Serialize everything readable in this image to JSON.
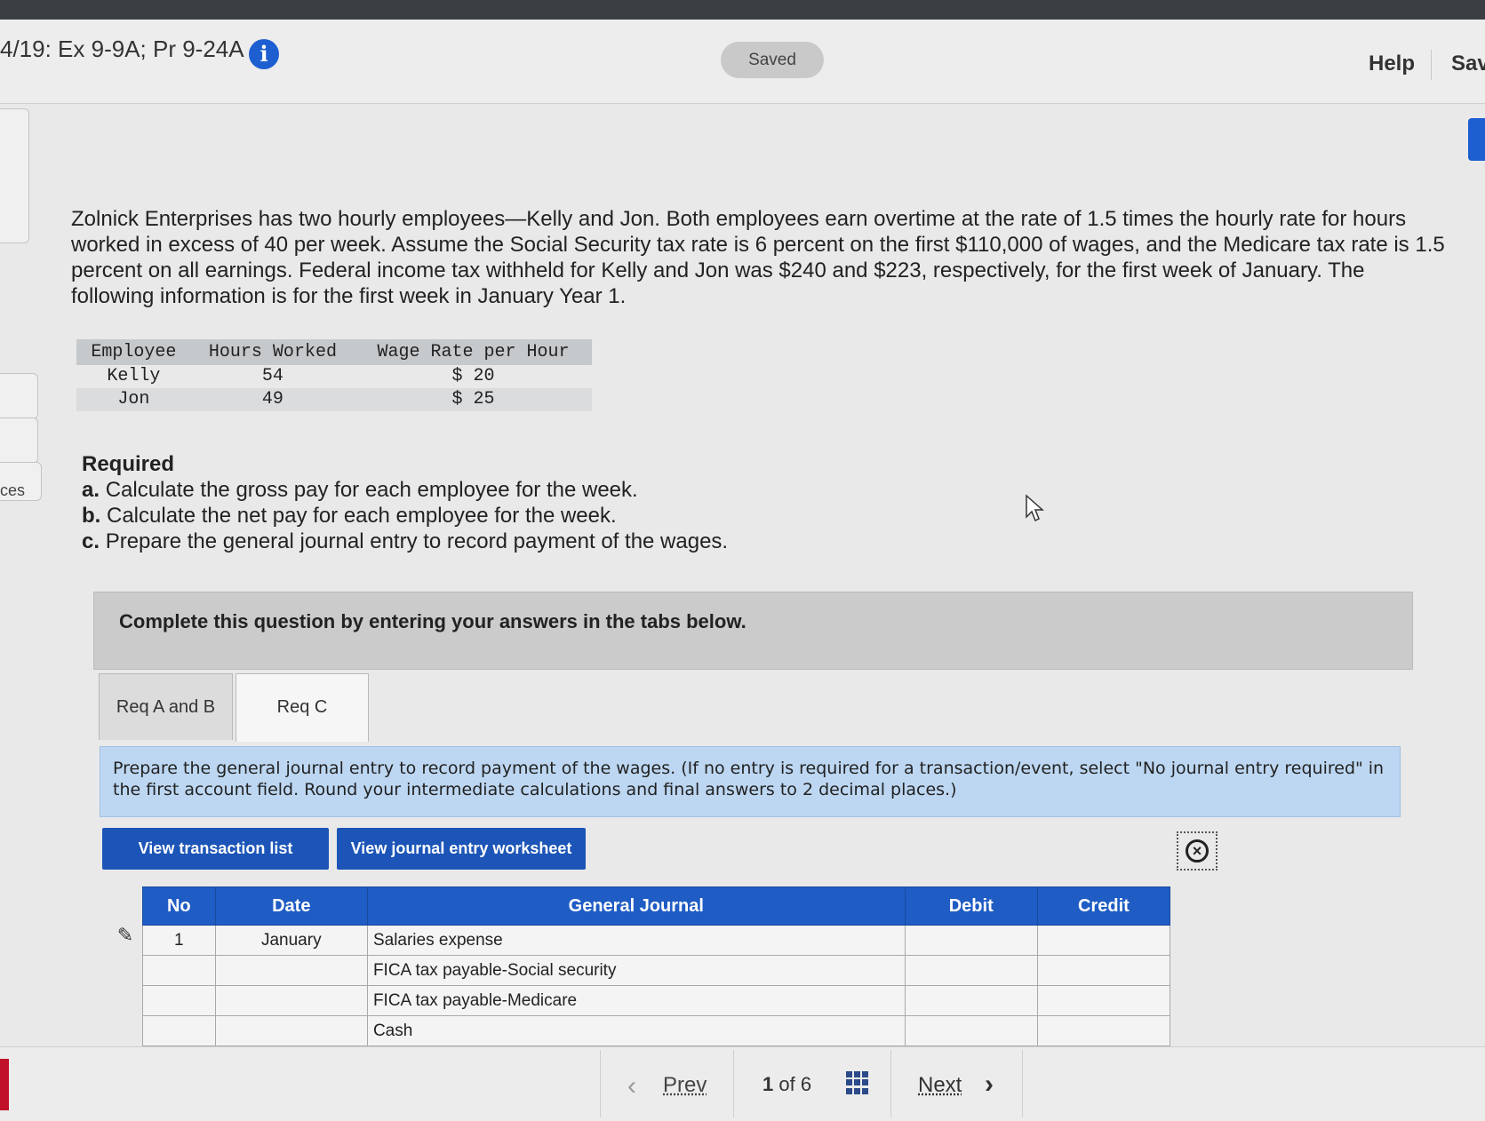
{
  "header": {
    "question_title": "4/19: Ex 9-9A; Pr 9-24A",
    "info_symbol": "i",
    "status": "Saved",
    "help": "Help",
    "save": "Sav"
  },
  "sidebar": {
    "partial_label": "ces"
  },
  "problem": {
    "text": "Zolnick Enterprises has two hourly employees—Kelly and Jon. Both employees earn overtime at the rate of 1.5 times the hourly rate for hours worked in excess of 40 per week. Assume the Social Security tax rate is 6 percent on the first $110,000 of wages, and the Medicare tax rate is 1.5 percent on all earnings. Federal income tax withheld for Kelly and Jon was $240 and $223, respectively, for the first week of January. The following information is for the first week in January Year 1."
  },
  "employee_table": {
    "headers": [
      "Employee",
      "Hours Worked",
      "Wage Rate per Hour"
    ],
    "rows": [
      [
        "Kelly",
        "54",
        "$ 20"
      ],
      [
        "Jon",
        "49",
        "$ 25"
      ]
    ]
  },
  "required": {
    "heading": "Required",
    "items": [
      {
        "letter": "a.",
        "text": "Calculate the gross pay for each employee for the week."
      },
      {
        "letter": "b.",
        "text": "Calculate the net pay for each employee for the week."
      },
      {
        "letter": "c.",
        "text": "Prepare the general journal entry to record payment of the wages."
      }
    ]
  },
  "complete_banner": "Complete this question by entering your answers in the tabs below.",
  "tabs": [
    {
      "label": "Req A and B",
      "active": false
    },
    {
      "label": "Req C",
      "active": true
    }
  ],
  "instruction": "Prepare the general journal entry to record payment of the wages. (If no entry is required for a transaction/event, select \"No journal entry required\" in the first account field. Round your intermediate calculations and final answers to 2 decimal places.)",
  "buttons": {
    "view_transaction_list": "View transaction list",
    "view_journal_worksheet": "View journal entry worksheet",
    "close_symbol": "×"
  },
  "journal": {
    "headers": [
      "No",
      "Date",
      "General Journal",
      "Debit",
      "Credit"
    ],
    "rows": [
      [
        "1",
        "January",
        "Salaries expense",
        "",
        ""
      ],
      [
        "",
        "",
        "FICA tax payable-Social security",
        "",
        ""
      ],
      [
        "",
        "",
        "FICA tax payable-Medicare",
        "",
        ""
      ],
      [
        "",
        "",
        "Cash",
        "",
        ""
      ]
    ]
  },
  "pager": {
    "prev": "Prev",
    "current": "1",
    "of": "of",
    "total": "6",
    "next": "Next"
  },
  "colors": {
    "primary_blue": "#1c55b7",
    "table_header_blue": "#1f5cc4",
    "instruction_bg": "#bdd7f2"
  }
}
